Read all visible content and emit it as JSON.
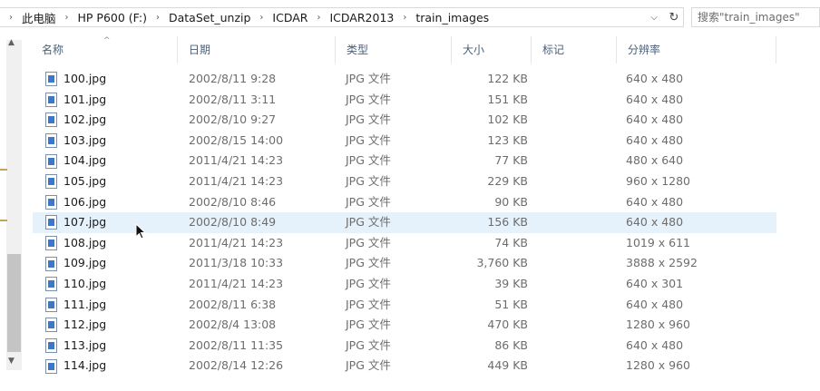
{
  "address": {
    "crumbs": [
      "此电脑",
      "HP P600 (F:)",
      "DataSet_unzip",
      "ICDAR",
      "ICDAR2013",
      "train_images"
    ],
    "search_placeholder": "搜索\"train_images\""
  },
  "columns": {
    "name": "名称",
    "date": "日期",
    "type": "类型",
    "size": "大小",
    "tags": "标记",
    "dimensions": "分辨率"
  },
  "files": [
    {
      "name": "100.jpg",
      "date": "2002/8/11 9:28",
      "type": "JPG 文件",
      "size": "122 KB",
      "dimensions": "640 x 480"
    },
    {
      "name": "101.jpg",
      "date": "2002/8/11 3:11",
      "type": "JPG 文件",
      "size": "151 KB",
      "dimensions": "640 x 480"
    },
    {
      "name": "102.jpg",
      "date": "2002/8/10 9:27",
      "type": "JPG 文件",
      "size": "102 KB",
      "dimensions": "640 x 480"
    },
    {
      "name": "103.jpg",
      "date": "2002/8/15 14:00",
      "type": "JPG 文件",
      "size": "123 KB",
      "dimensions": "640 x 480"
    },
    {
      "name": "104.jpg",
      "date": "2011/4/21 14:23",
      "type": "JPG 文件",
      "size": "77 KB",
      "dimensions": "480 x 640"
    },
    {
      "name": "105.jpg",
      "date": "2011/4/21 14:23",
      "type": "JPG 文件",
      "size": "229 KB",
      "dimensions": "960 x 1280"
    },
    {
      "name": "106.jpg",
      "date": "2002/8/10 8:46",
      "type": "JPG 文件",
      "size": "90 KB",
      "dimensions": "640 x 480"
    },
    {
      "name": "107.jpg",
      "date": "2002/8/10 8:49",
      "type": "JPG 文件",
      "size": "156 KB",
      "dimensions": "640 x 480",
      "selected": true
    },
    {
      "name": "108.jpg",
      "date": "2011/4/21 14:23",
      "type": "JPG 文件",
      "size": "74 KB",
      "dimensions": "1019 x 611"
    },
    {
      "name": "109.jpg",
      "date": "2011/3/18 10:33",
      "type": "JPG 文件",
      "size": "3,760 KB",
      "dimensions": "3888 x 2592"
    },
    {
      "name": "110.jpg",
      "date": "2011/4/21 14:23",
      "type": "JPG 文件",
      "size": "39 KB",
      "dimensions": "640 x 301"
    },
    {
      "name": "111.jpg",
      "date": "2002/8/11 6:38",
      "type": "JPG 文件",
      "size": "51 KB",
      "dimensions": "640 x 480"
    },
    {
      "name": "112.jpg",
      "date": "2002/8/4 13:08",
      "type": "JPG 文件",
      "size": "470 KB",
      "dimensions": "1280 x 960"
    },
    {
      "name": "113.jpg",
      "date": "2002/8/11 11:35",
      "type": "JPG 文件",
      "size": "86 KB",
      "dimensions": "640 x 480"
    },
    {
      "name": "114.jpg",
      "date": "2002/8/14 12:26",
      "type": "JPG 文件",
      "size": "449 KB",
      "dimensions": "1280 x 960"
    }
  ],
  "colors": {
    "selection": "#e5f1fb",
    "header_text": "#4c607a",
    "secondary_text": "#6d6d6d"
  }
}
